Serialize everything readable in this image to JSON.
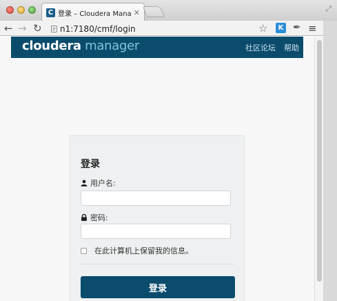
{
  "browser": {
    "tab_title": "登录 – Cloudera Manager",
    "tab_favicon_letter": "C",
    "url": "n1:7180/cmf/login",
    "extension_letter": "K",
    "icons": {
      "back": "back-arrow-icon",
      "forward": "forward-arrow-icon",
      "reload": "reload-icon",
      "bookmark": "star-icon",
      "menu": "hamburger-menu-icon"
    }
  },
  "header": {
    "logo_part1": "cloudera",
    "logo_part2": " manager",
    "links": [
      "社区论坛",
      "帮助"
    ],
    "background": "#0b4c6d"
  },
  "login": {
    "title": "登录",
    "username_label": "用户名:",
    "password_label": "密码:",
    "username_value": "",
    "password_value": "",
    "remember_label": "在此计算机上保留我的信息。",
    "remember_checked": false,
    "submit_label": "登录",
    "button_color": "#0b4c6d"
  }
}
